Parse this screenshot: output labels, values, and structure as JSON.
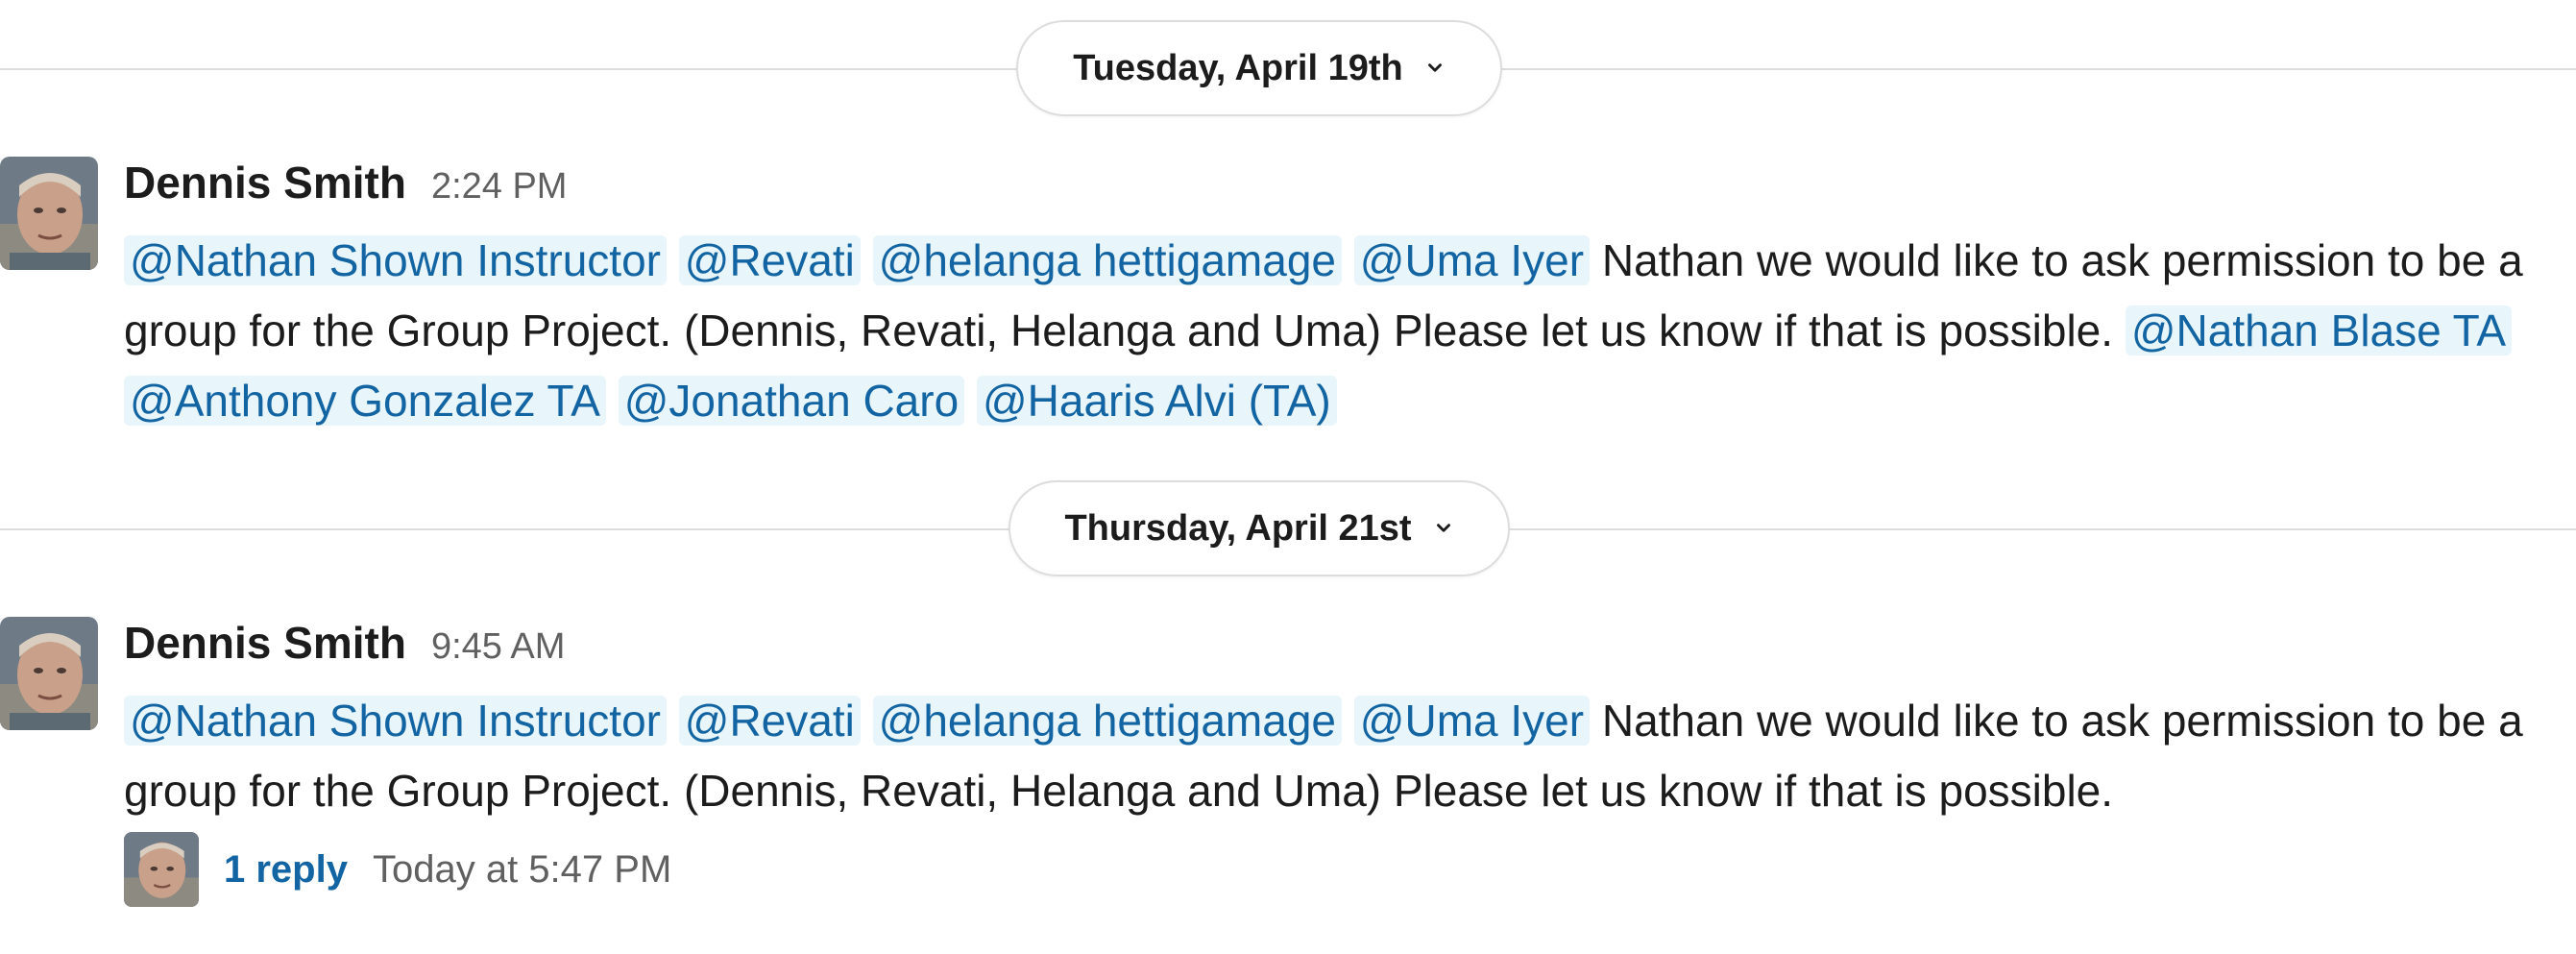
{
  "channel": {
    "date_dividers": [
      {
        "label": "Tuesday, April 19th"
      },
      {
        "label": "Thursday, April 21st"
      }
    ],
    "messages": [
      {
        "author": "Dennis Smith",
        "time": "2:24 PM",
        "mentions_lead": [
          "@Nathan Shown Instructor",
          "@Revati",
          "@helanga hettigamage",
          "@Uma Iyer"
        ],
        "text": "Nathan we would like to ask permission to be a group for the Group Project. (Dennis, Revati, Helanga and Uma) Please let us know if that is possible.",
        "mentions_tail": [
          "@Nathan Blase TA",
          "@Anthony Gonzalez TA",
          "@Jonathan Caro",
          "@Haaris Alvi (TA)"
        ]
      },
      {
        "author": "Dennis Smith",
        "time": "9:45 AM",
        "mentions_lead": [
          "@Nathan Shown Instructor",
          "@Revati",
          "@helanga hettigamage",
          "@Uma Iyer"
        ],
        "text": "Nathan we would like to ask permission to be a group for the Group Project. (Dennis, Revati, Helanga and Uma) Please let us know if that is possible.",
        "thread": {
          "reply_count": "1 reply",
          "last_reply": "Today at 5:47 PM"
        }
      }
    ]
  },
  "icons": {
    "date_chevron": "chevron-down-icon",
    "avatar": "user-avatar"
  },
  "colors": {
    "mention_text": "#1264a3",
    "mention_bg": "#e8f5fa",
    "divider": "#dddddd",
    "muted": "#616061"
  }
}
